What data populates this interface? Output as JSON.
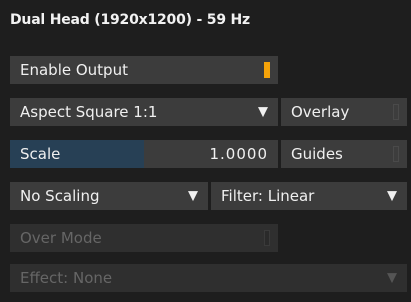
{
  "header": {
    "title": "Dual Head (1920x1200) - 59 Hz"
  },
  "controls": {
    "enable_output": {
      "label": "Enable Output",
      "state": "on"
    },
    "aspect": {
      "value": "Aspect Square 1:1"
    },
    "overlay": {
      "label": "Overlay",
      "state": "off"
    },
    "scale": {
      "label": "Scale",
      "value": "1.0000",
      "fill_fraction": 0.5
    },
    "guides": {
      "label": "Guides",
      "state": "off"
    },
    "scaling": {
      "value": "No Scaling"
    },
    "filter": {
      "value": "Filter: Linear"
    },
    "over_mode": {
      "label": "Over Mode",
      "state": "off",
      "enabled": false
    },
    "effect": {
      "value": "Effect: None",
      "enabled": false
    }
  },
  "icons": {
    "dropdown": "▼"
  },
  "colors": {
    "accent": "#f5a30a",
    "scale_fill": "#274055",
    "control_bg": "#3c3c3c"
  }
}
